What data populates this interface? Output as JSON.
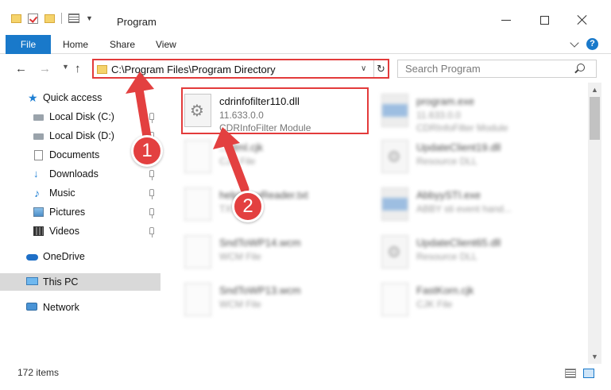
{
  "window": {
    "title": "Program"
  },
  "ribbon": {
    "file_label": "File",
    "home_label": "Home",
    "share_label": "Share",
    "view_label": "View",
    "help_label": "?"
  },
  "address_bar": {
    "path": "C:\\Program Files\\Program Directory"
  },
  "search": {
    "placeholder": "Search Program"
  },
  "nav_pane": {
    "items": [
      {
        "label": "Quick access"
      },
      {
        "label": "Local Disk (C:)"
      },
      {
        "label": "Local Disk (D:)"
      },
      {
        "label": "Documents"
      },
      {
        "label": "Downloads"
      },
      {
        "label": "Music"
      },
      {
        "label": "Pictures"
      },
      {
        "label": "Videos"
      },
      {
        "label": "OneDrive"
      },
      {
        "label": "This PC"
      },
      {
        "label": "Network"
      }
    ]
  },
  "files": [
    {
      "name": "cdrinfofilter110.dll",
      "line1": "11.633.0.0",
      "line2": "CDRInfoFilter Module"
    },
    {
      "name": "program.exe",
      "line1": "11.633.0.0",
      "line2": "CDRInfoFilter Module"
    },
    {
      "name": "...html.cjk",
      "line1": "CJK File",
      "line2": ""
    },
    {
      "name": "UpdateClient19.dll",
      "line1": "Resource DLL",
      "line2": ""
    },
    {
      "name": "helpViewReader.txt",
      "line1": "TXT File",
      "line2": ""
    },
    {
      "name": "AbbyySTI.exe",
      "line1": "ABBY sti event hand...",
      "line2": ""
    },
    {
      "name": "SndToWP14.wcm",
      "line1": "WCM File",
      "line2": ""
    },
    {
      "name": "UpdateClient65.dll",
      "line1": "Resource DLL",
      "line2": ""
    },
    {
      "name": "SndToWP13.wcm",
      "line1": "WCM File",
      "line2": ""
    },
    {
      "name": "FastKorn.cjk",
      "line1": "CJK File",
      "line2": ""
    }
  ],
  "status": {
    "item_count": "172 items"
  },
  "annotations": {
    "badge1": "1",
    "badge2": "2",
    "accent_color": "#e34040"
  }
}
